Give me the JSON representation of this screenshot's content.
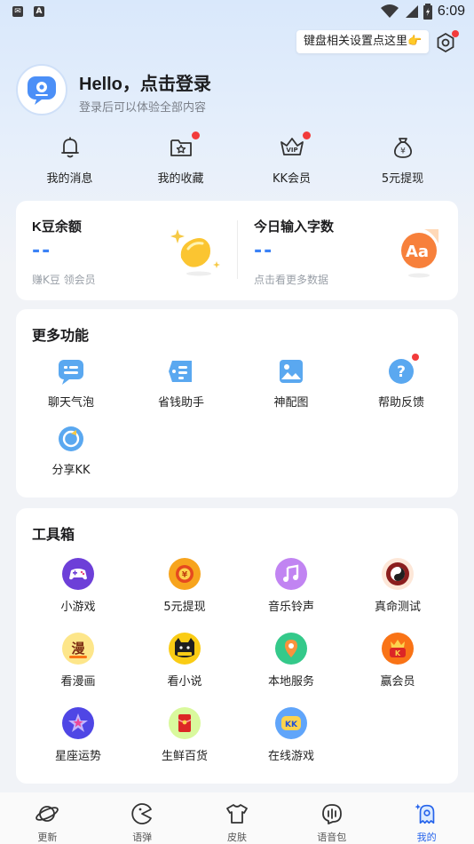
{
  "status_bar": {
    "time": "6:09",
    "left_icons": [
      "mail-icon",
      "keyboard-a-icon"
    ],
    "battery_icon": "battery-icon"
  },
  "tip": {
    "text": "键盘相关设置点这里👉"
  },
  "profile": {
    "greeting": "Hello，点击登录",
    "subtitle": "登录后可以体验全部内容"
  },
  "quick_actions": [
    {
      "label": "我的消息",
      "icon": "bell-icon",
      "badge": false
    },
    {
      "label": "我的收藏",
      "icon": "folder-star-icon",
      "badge": true
    },
    {
      "label": "KK会员",
      "icon": "vip-crown-icon",
      "badge": true
    },
    {
      "label": "5元提现",
      "icon": "money-bag-icon",
      "badge": false
    }
  ],
  "stats": {
    "left": {
      "title": "K豆余额",
      "value": "--",
      "sub": "赚K豆 领会员"
    },
    "right": {
      "title": "今日输入字数",
      "value": "--",
      "sub": "点击看更多数据"
    }
  },
  "more_features": {
    "title": "更多功能",
    "items": [
      {
        "label": "聊天气泡",
        "icon": "chat-bubble-icon",
        "badge": false
      },
      {
        "label": "省钱助手",
        "icon": "coupon-icon",
        "badge": false
      },
      {
        "label": "神配图",
        "icon": "image-icon",
        "badge": false
      },
      {
        "label": "帮助反馈",
        "icon": "help-icon",
        "badge": true
      },
      {
        "label": "分享KK",
        "icon": "share-icon",
        "badge": false
      }
    ]
  },
  "toolbox": {
    "title": "工具箱",
    "items": [
      {
        "label": "小游戏",
        "icon": "gamepad-icon"
      },
      {
        "label": "5元提现",
        "icon": "cash-coin-icon"
      },
      {
        "label": "音乐铃声",
        "icon": "music-note-icon"
      },
      {
        "label": "真命测试",
        "icon": "yin-yang-icon"
      },
      {
        "label": "看漫画",
        "icon": "comic-icon"
      },
      {
        "label": "看小说",
        "icon": "cat-book-icon"
      },
      {
        "label": "本地服务",
        "icon": "location-pin-icon"
      },
      {
        "label": "赢会员",
        "icon": "member-gift-icon"
      },
      {
        "label": "星座运势",
        "icon": "star-sign-icon"
      },
      {
        "label": "生鲜百货",
        "icon": "red-packet-icon"
      },
      {
        "label": "在线游戏",
        "icon": "kk-game-icon"
      }
    ]
  },
  "tabs": [
    {
      "label": "更新",
      "icon": "planet-icon",
      "active": false
    },
    {
      "label": "语弹",
      "icon": "pacman-icon",
      "active": false
    },
    {
      "label": "皮肤",
      "icon": "tshirt-icon",
      "active": false
    },
    {
      "label": "语音包",
      "icon": "voice-wave-icon",
      "active": false
    },
    {
      "label": "我的",
      "icon": "ghost-icon",
      "active": true
    }
  ],
  "colors": {
    "accent": "#2563eb",
    "badge": "#f23b3b",
    "value": "#3b82f6"
  }
}
